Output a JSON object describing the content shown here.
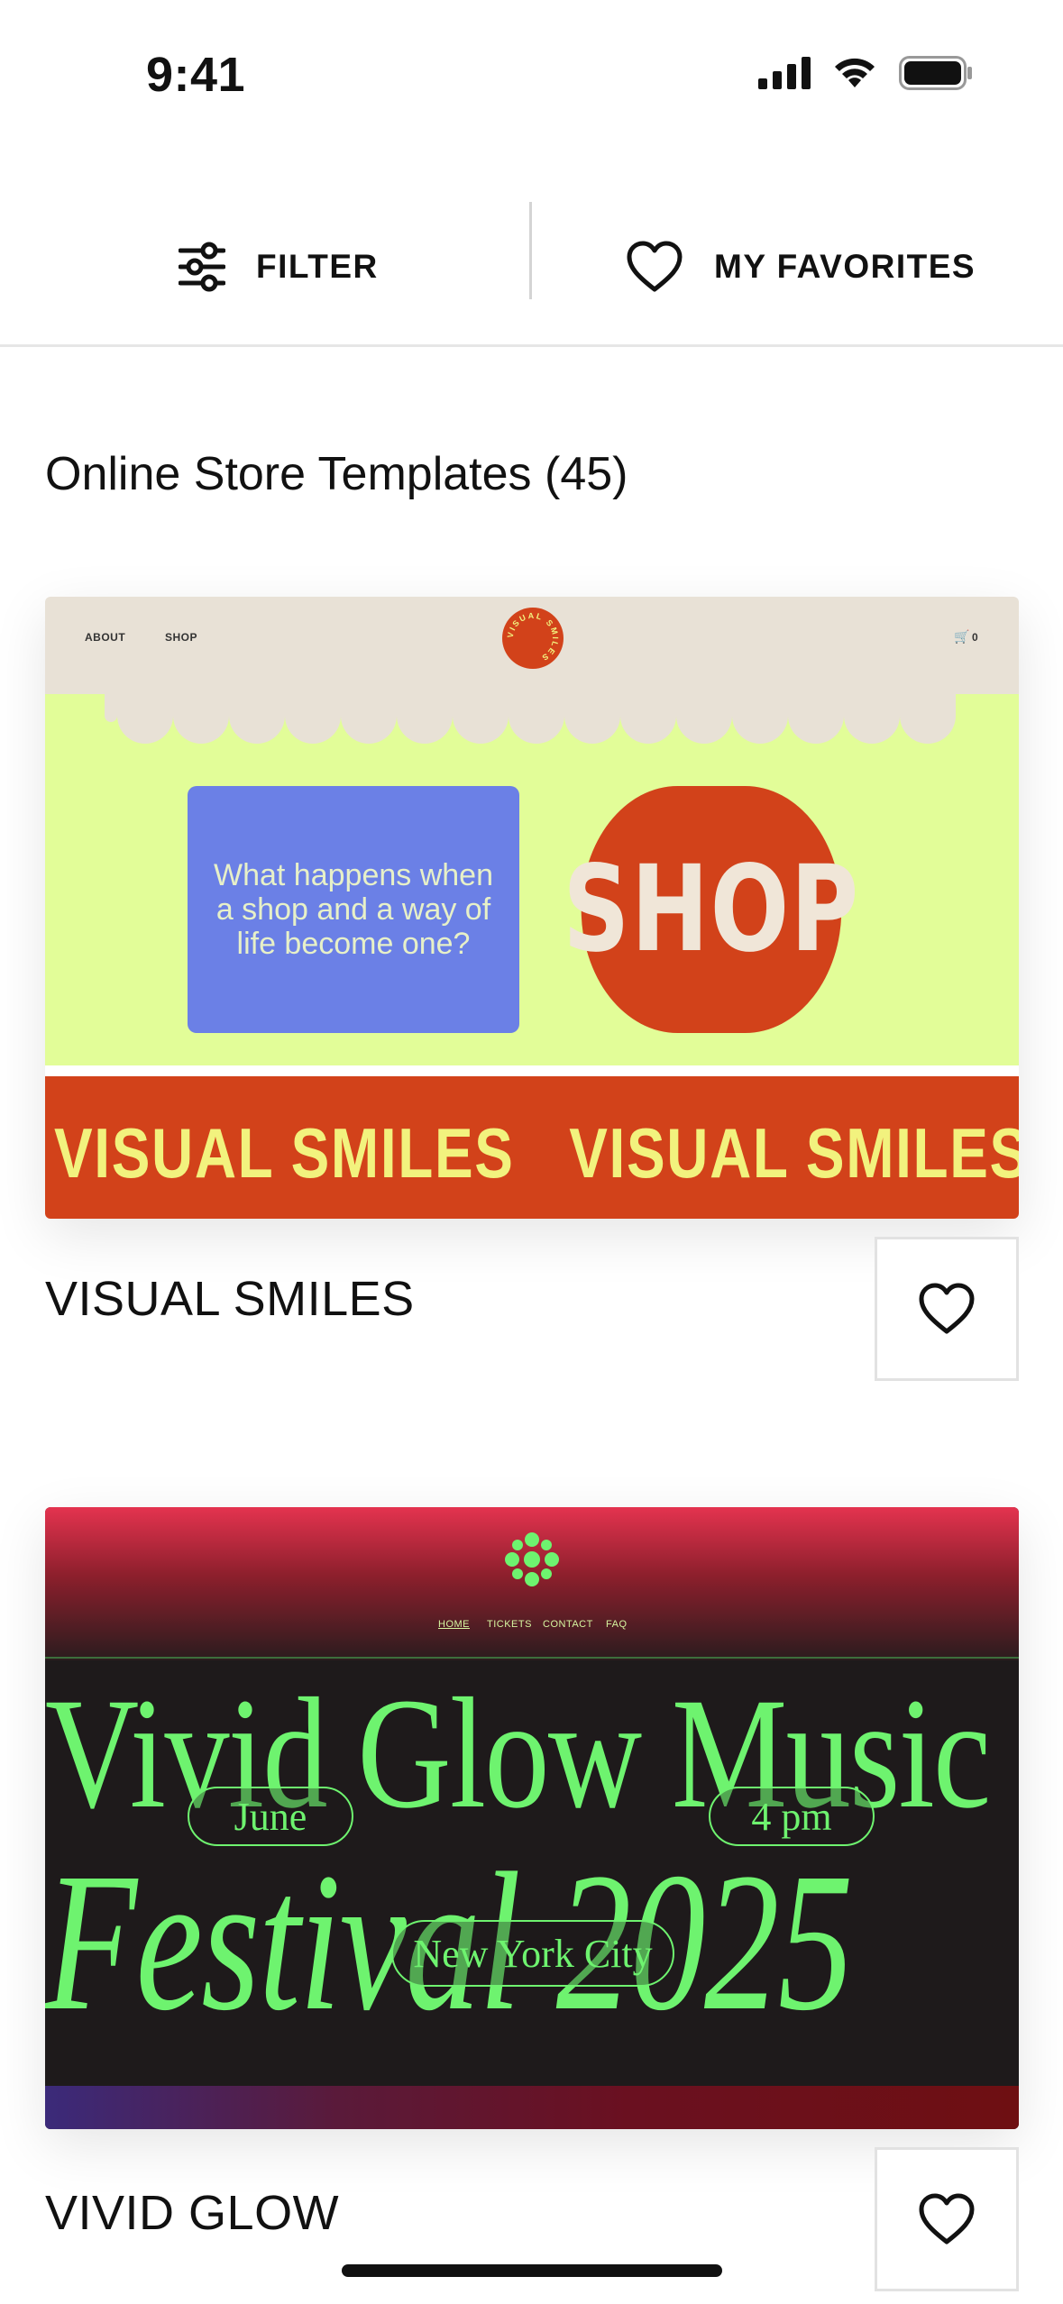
{
  "status_bar": {
    "time": "9:41"
  },
  "toolbar": {
    "filter_label": "FILTER",
    "favorites_label": "MY FAVORITES"
  },
  "section": {
    "title": "Online Store Templates (45)"
  },
  "templates": [
    {
      "name": "VISUAL SMILES",
      "preview": {
        "nav": [
          "ABOUT",
          "SHOP"
        ],
        "cart_count": "0",
        "logo_text": "VISUAL SMILES",
        "blurb": "What happens when a shop and a way of life become one?",
        "cta": "SHOP",
        "band_text": "VISUAL SMILES",
        "colors": {
          "header": "#e8e1d6",
          "body": "#e2fd98",
          "accent": "#d2421a",
          "blue": "#6b80e6"
        }
      }
    },
    {
      "name": "VIVID GLOW",
      "preview": {
        "nav": [
          "HOME",
          "TICKETS",
          "CONTACT",
          "FAQ"
        ],
        "headline_1": "Vivid Glow Music",
        "headline_2": "Festival 2025",
        "pills": [
          "June",
          "4 pm",
          "New York City"
        ],
        "colors": {
          "text": "#6ef36f",
          "background": "#1e1a1b",
          "top": "#e4334f"
        }
      }
    }
  ]
}
